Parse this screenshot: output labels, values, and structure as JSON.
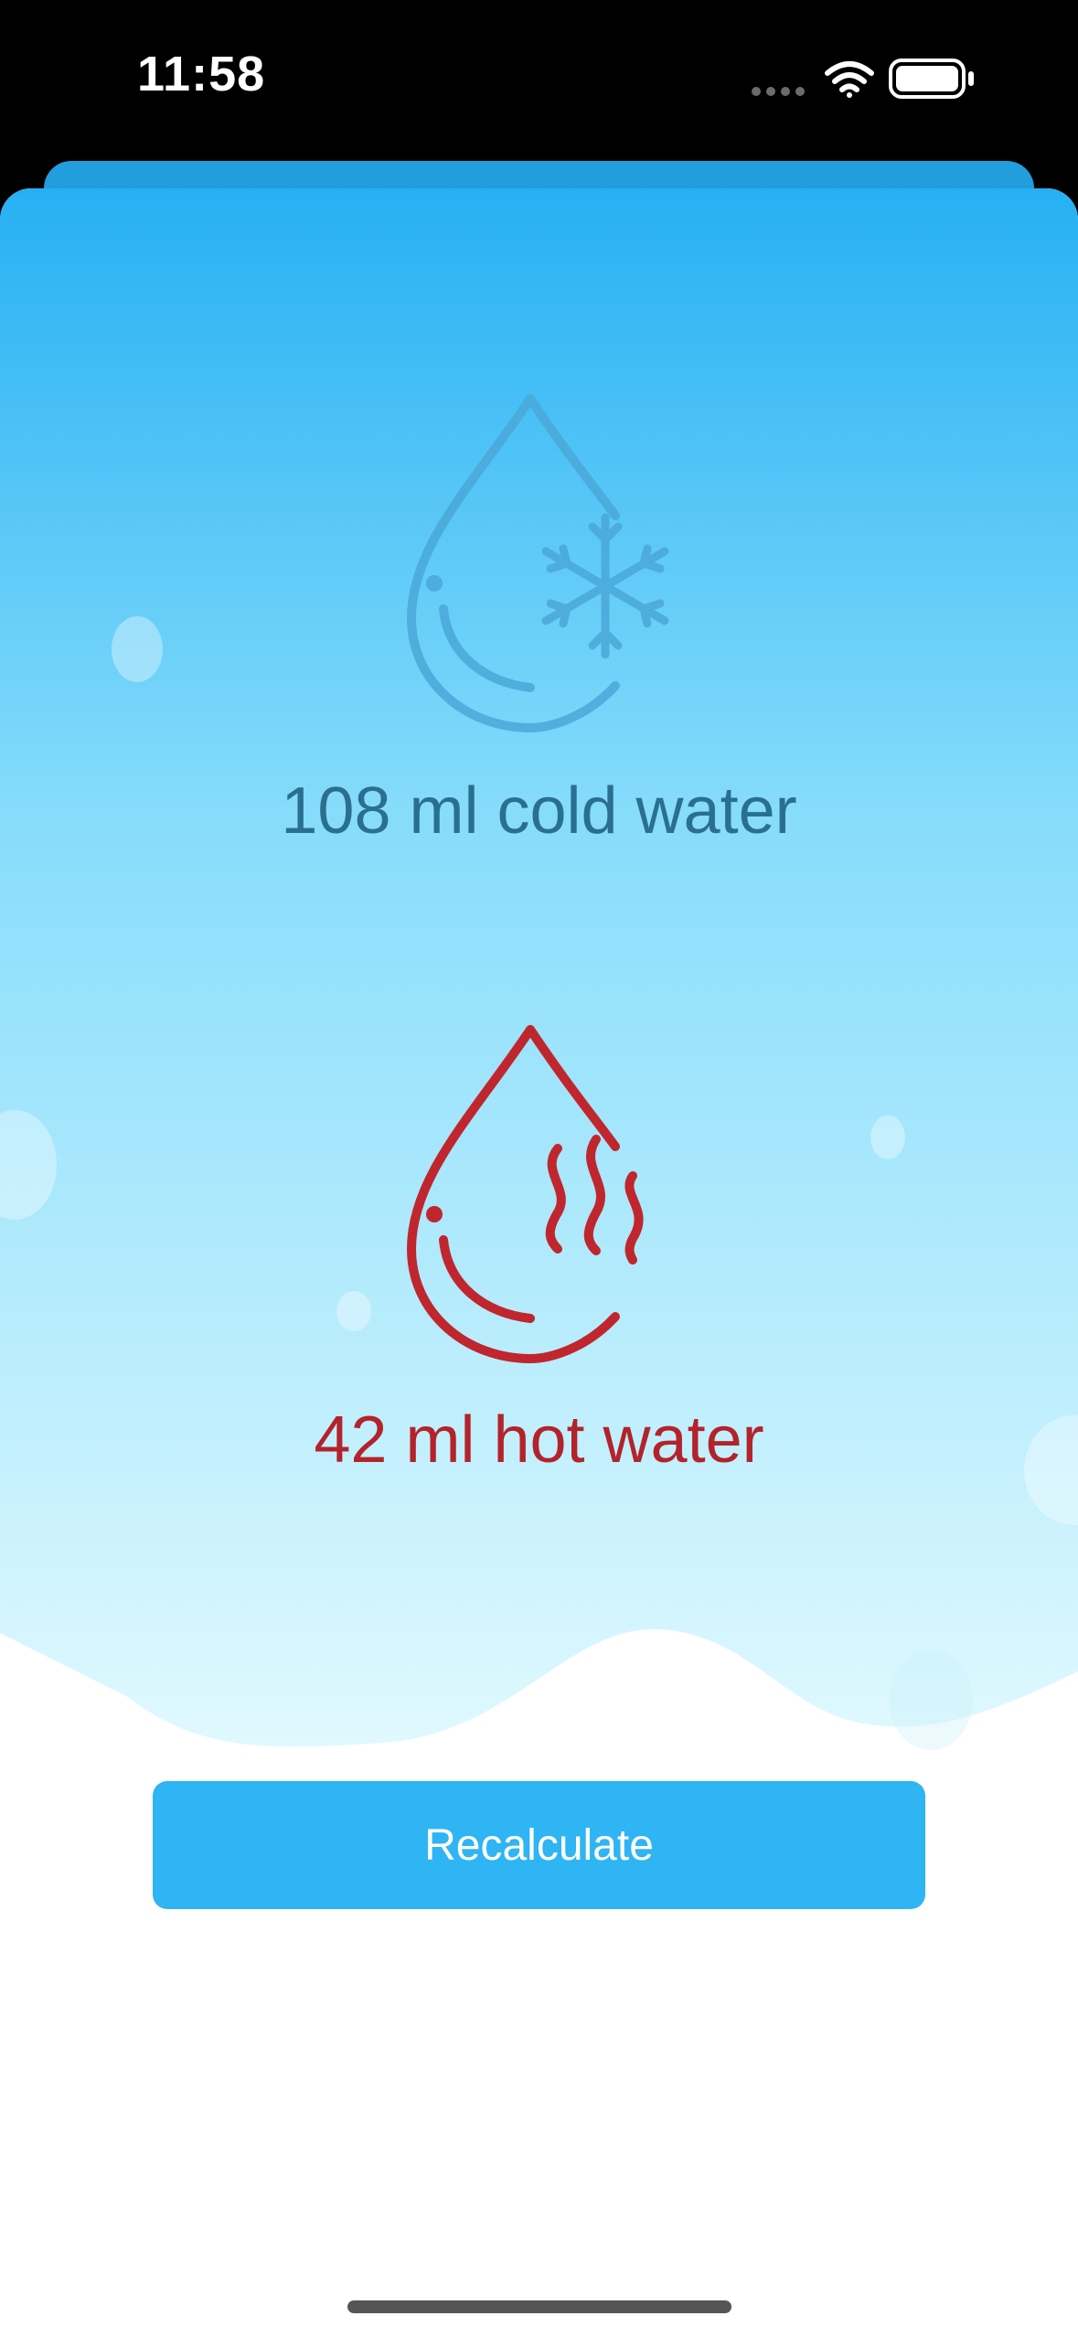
{
  "status_bar": {
    "time": "11:58",
    "icons": [
      "cellular-dots-icon",
      "wifi-icon",
      "battery-icon"
    ]
  },
  "result": {
    "cold": {
      "text": "108 ml cold water",
      "icon": "cold-water-drop-icon",
      "color": "#2b6f90"
    },
    "hot": {
      "text": "42 ml hot water",
      "icon": "hot-water-drop-icon",
      "color": "#b3232b"
    }
  },
  "actions": {
    "recalculate_label": "Recalculate"
  },
  "colors": {
    "gradient_top": "#26b0f3",
    "gradient_mid": "#86dcfb",
    "gradient_bottom": "#e0f9fe",
    "button": "#2fb4f4",
    "sheet_back": "#229ddd"
  }
}
